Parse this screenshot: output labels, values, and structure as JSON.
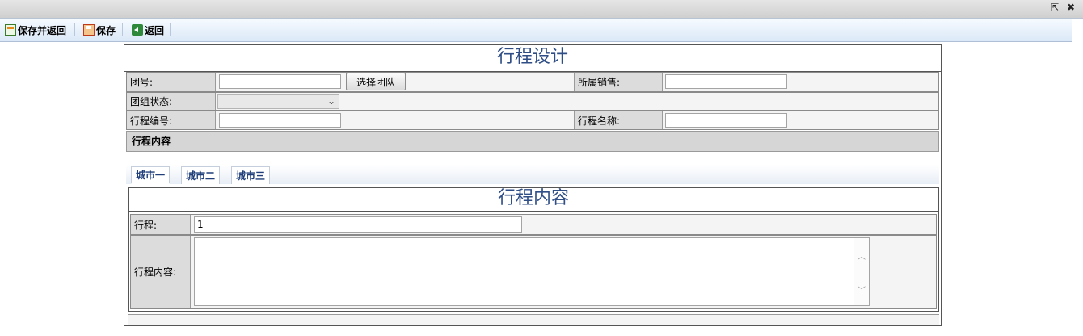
{
  "window": {
    "popout_icon": "popout-icon",
    "close_icon": "close-icon"
  },
  "toolbar": {
    "save_return_label": "保存并返回",
    "save_label": "保存",
    "back_label": "返回"
  },
  "form": {
    "title": "行程设计",
    "group_no": {
      "label": "团号:",
      "value": ""
    },
    "select_team_button": "选择团队",
    "sales": {
      "label": "所属销售:",
      "value": ""
    },
    "group_status": {
      "label": "团组状态:",
      "value": ""
    },
    "itinerary_no": {
      "label": "行程编号:",
      "value": ""
    },
    "itinerary_name": {
      "label": "行程名称:",
      "value": ""
    },
    "content_section_title": "行程内容"
  },
  "tabs": [
    {
      "label": "城市一",
      "active": true
    },
    {
      "label": "城市二",
      "active": false
    },
    {
      "label": "城市三",
      "active": false
    }
  ],
  "itinerary": {
    "title": "行程内容",
    "day": {
      "label": "行程:",
      "value": "1"
    },
    "content": {
      "label": "行程内容:",
      "value": ""
    }
  },
  "colors": {
    "title_blue": "#2f4e86",
    "tab_text": "#1f3e7a",
    "label_bg": "#dcdcdc"
  }
}
